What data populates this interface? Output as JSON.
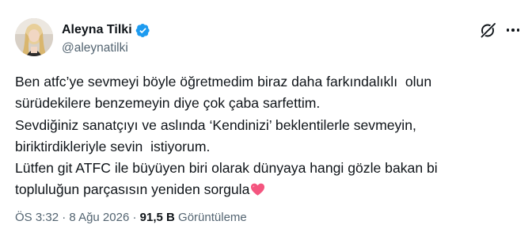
{
  "author": {
    "display_name": "Aleyna Tilki",
    "handle": "@aleynatilki",
    "verified": true,
    "verified_color": "#1d9bf0"
  },
  "icons": {
    "avatar": "profile-photo",
    "verified": "verified-badge-icon",
    "grok": "grok-icon",
    "more": "more-options-icon",
    "emoji": "sparkling-heart-emoji"
  },
  "tweet": {
    "lines": [
      "Ben atfc’ye sevmeyi böyle öğretmedim biraz daha farkındalıklı  olun",
      "sürüdekilere benzemeyin diye çok çaba sarfettim.",
      "Sevdiğiniz sanatçıyı ve aslında ‘Kendinizi’ beklentilerle sevmeyin,",
      "biriktirdikleriyle sevin  istiyorum.",
      "Lütfen git ATFC ile büyüyen biri olarak dünyaya hangi gözle bakan bi",
      "topluluğun parçasısın yeniden sorgula"
    ]
  },
  "meta": {
    "time": "ÖS 3:32",
    "separator": " · ",
    "date": "8 Ağu 2026",
    "views_count": "91,5 B",
    "views_label": "Görüntüleme"
  },
  "colors": {
    "text_primary": "#0f1419",
    "text_secondary": "#536471",
    "heart": "#f4557f"
  }
}
